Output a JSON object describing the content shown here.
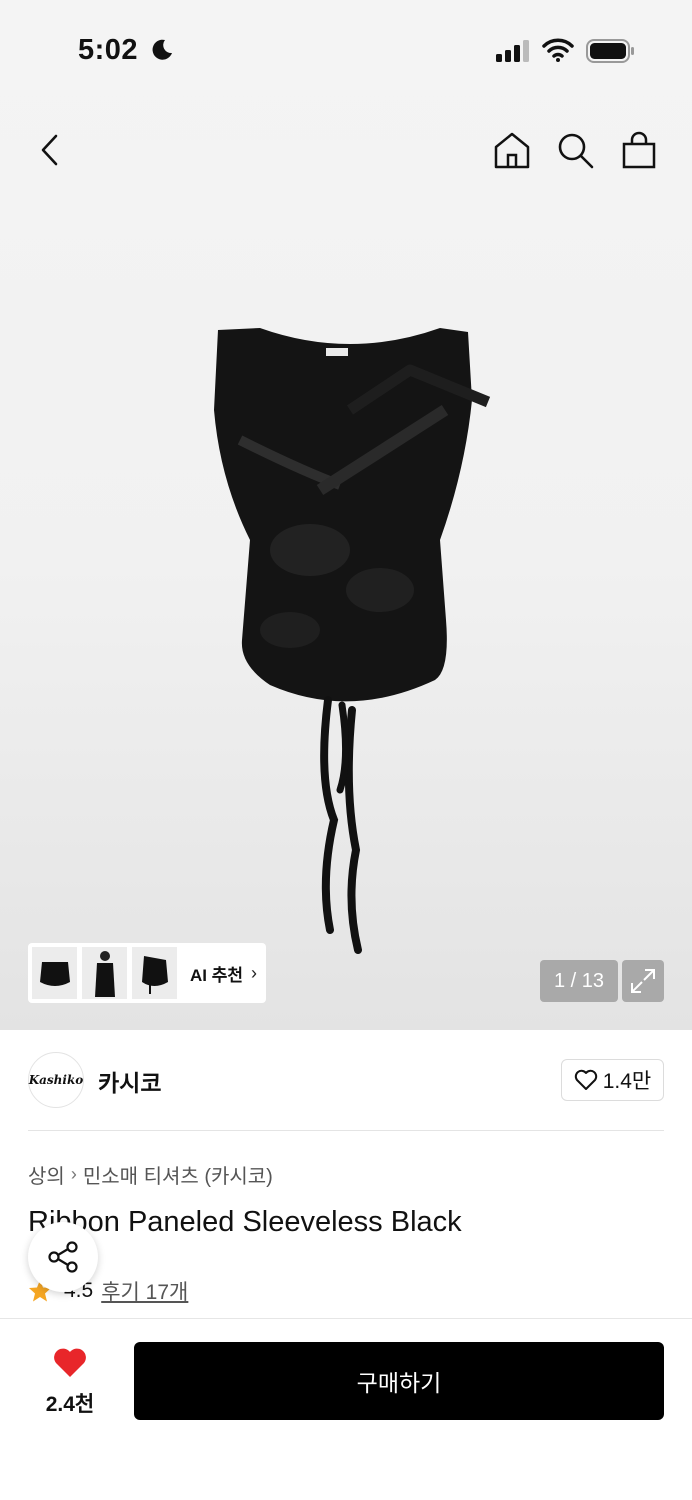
{
  "status_bar": {
    "time": "5:02"
  },
  "gallery": {
    "ai_label": "AI 추천",
    "counter": "1 / 13"
  },
  "brand": {
    "logo_text": "Kashiko",
    "name": "카시코",
    "likes": "1.4만"
  },
  "product": {
    "category_1": "상의",
    "category_2": "민소매 티셔츠 (카시코)",
    "title": "Ribbon Paneled Sleeveless Black",
    "rating": "4.5",
    "reviews": "후기 17개"
  },
  "bottom": {
    "wish_count": "2.4천",
    "buy_label": "구매하기"
  },
  "colors": {
    "accent_red": "#e8262a",
    "star": "#f5a623",
    "buy_button": "#000000"
  }
}
